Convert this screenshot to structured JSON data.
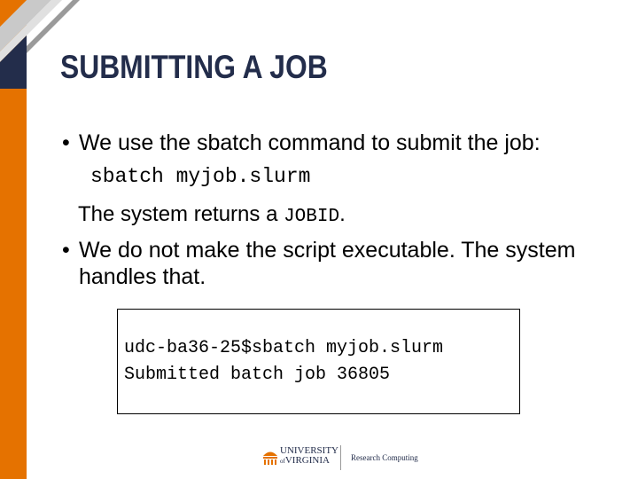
{
  "slide": {
    "title": "SUBMITTING A JOB",
    "bullets": [
      {
        "marker": "•",
        "text": "We use the sbatch command to submit the job:"
      },
      {
        "marker": "•",
        "text": "We do not make the script executable.  The system handles that."
      }
    ],
    "command": "sbatch myjob.slurm",
    "returns_prefix": "The system returns a ",
    "returns_code": "JOBID",
    "returns_suffix": "."
  },
  "terminal": {
    "lines": [
      "udc-ba36-25$sbatch myjob.slurm",
      "Submitted batch job 36805"
    ]
  },
  "footer": {
    "university_line1": "UNIVERSITY",
    "university_of": "of",
    "university_line2": "VIRGINIA",
    "department": "Research Computing"
  },
  "colors": {
    "accent_orange": "#e57200",
    "title_navy": "#232d4b"
  }
}
